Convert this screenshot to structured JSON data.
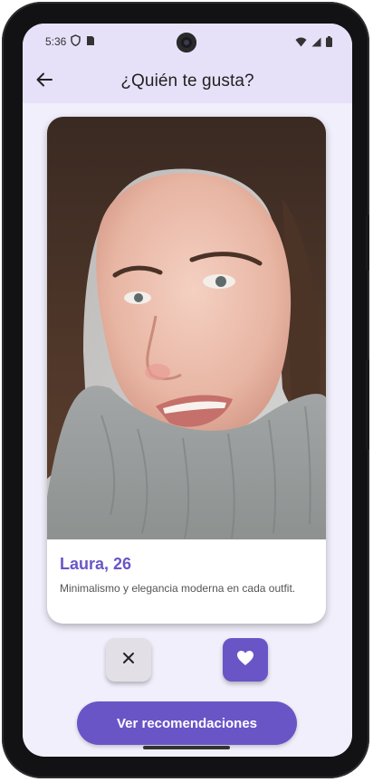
{
  "status_bar": {
    "time": "5:36",
    "icons_left": [
      "shield-icon",
      "sim-card-icon"
    ],
    "icons_right": [
      "wifi-icon",
      "signal-icon",
      "battery-icon"
    ]
  },
  "app_bar": {
    "title": "¿Quién te gusta?",
    "back_icon": "arrow-back-icon"
  },
  "profile_card": {
    "name_age": "Laura, 26",
    "description": "Minimalismo y elegancia moderna en cada outfit."
  },
  "actions": {
    "dislike_icon": "close-icon",
    "like_icon": "heart-icon"
  },
  "cta": {
    "label": "Ver recomendaciones"
  },
  "colors": {
    "accent": "#6a55c7",
    "app_bar_bg": "#e6e1f8",
    "screen_bg": "#f1effb",
    "dislike_bg": "#e2e0e6"
  }
}
